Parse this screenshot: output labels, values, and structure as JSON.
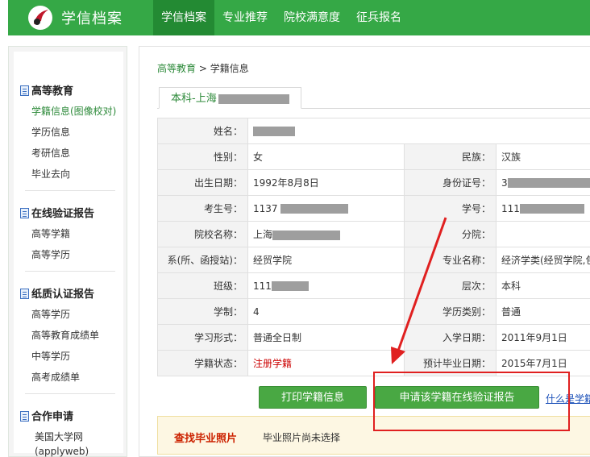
{
  "header": {
    "logo_text": "学信档案",
    "nav": [
      "学信档案",
      "专业推荐",
      "院校满意度",
      "征兵报名"
    ],
    "active_nav": 0
  },
  "sidebar": {
    "sections": [
      {
        "title": "高等教育",
        "items": [
          "学籍信息(图像校对)",
          "学历信息",
          "考研信息",
          "毕业去向"
        ],
        "active_item": 0
      },
      {
        "title": "在线验证报告",
        "items": [
          "高等学籍",
          "高等学历"
        ]
      },
      {
        "title": "纸质认证报告",
        "items": [
          "高等学历",
          "高等教育成绩单",
          "中等学历",
          "高考成绩单"
        ]
      },
      {
        "title": "合作申请",
        "items": [
          "美国大学网",
          "(applyweb)"
        ]
      }
    ]
  },
  "breadcrumb": {
    "link": "高等教育",
    "sep": " > ",
    "current": "学籍信息"
  },
  "tab": {
    "label": "本科-上海"
  },
  "info": {
    "name": {
      "label": "姓名：",
      "value": ""
    },
    "gender": {
      "label": "性别：",
      "value": "女"
    },
    "ethnicity": {
      "label": "民族：",
      "value": "汉族"
    },
    "birth": {
      "label": "出生日期：",
      "value": "1992年8月8日"
    },
    "id_no": {
      "label": "身份证号：",
      "value": "3"
    },
    "exam_no": {
      "label": "考生号：",
      "value": "1137"
    },
    "student_no": {
      "label": "学号：",
      "value": "111"
    },
    "school": {
      "label": "院校名称：",
      "value": "上海"
    },
    "branch": {
      "label": "分院：",
      "value": ""
    },
    "dept": {
      "label": "系(所、函授站)：",
      "value": "经贸学院"
    },
    "major": {
      "label": "专业名称：",
      "value": "经济学类(经贸学院,包"
    },
    "class": {
      "label": "班级：",
      "value": "111"
    },
    "level": {
      "label": "层次：",
      "value": "本科"
    },
    "duration": {
      "label": "学制：",
      "value": "4"
    },
    "category": {
      "label": "学历类别：",
      "value": "普通"
    },
    "form": {
      "label": "学习形式：",
      "value": "普通全日制"
    },
    "enroll": {
      "label": "入学日期：",
      "value": "2011年9月1日"
    },
    "status": {
      "label": "学籍状态：",
      "value": "注册学籍"
    },
    "grad": {
      "label": "预计毕业日期：",
      "value": "2015年7月1日"
    }
  },
  "actions": {
    "print": "打印学籍信息",
    "apply": "申请该学籍在线验证报告",
    "help": "什么是学籍"
  },
  "photo": {
    "title": "查找毕业照片",
    "message": "毕业照片尚未选择"
  },
  "colors": {
    "brand_green": "#35a846",
    "active_nav": "#238a33",
    "annotation_red": "#e02020"
  }
}
